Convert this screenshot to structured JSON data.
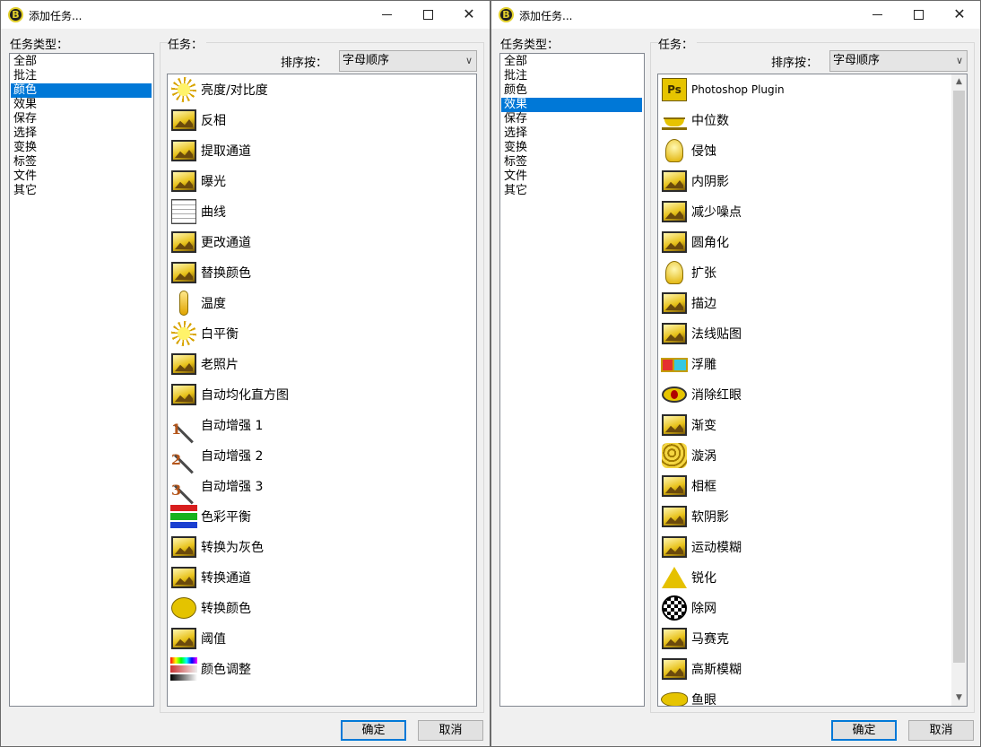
{
  "windows": [
    {
      "title": "添加任务...",
      "category_label": "任务类型：",
      "tasks_label": "任务：",
      "sort_label": "排序按：",
      "sort_value": "字母顺序",
      "categories": [
        "全部",
        "批注",
        "颜色",
        "效果",
        "保存",
        "选择",
        "变换",
        "标签",
        "文件",
        "其它"
      ],
      "selected_category": 2,
      "tasks": [
        {
          "label": "亮度/对比度",
          "icon": "brightness-sun-icon"
        },
        {
          "label": "反相",
          "icon": "invert-picture-icon"
        },
        {
          "label": "提取通道",
          "icon": "extract-channel-icon"
        },
        {
          "label": "曝光",
          "icon": "exposure-icon"
        },
        {
          "label": "曲线",
          "icon": "curves-grid-icon"
        },
        {
          "label": "更改通道",
          "icon": "change-channel-icon"
        },
        {
          "label": "替换颜色",
          "icon": "replace-color-icon"
        },
        {
          "label": "温度",
          "icon": "thermometer-icon"
        },
        {
          "label": "白平衡",
          "icon": "sun-sunglasses-icon"
        },
        {
          "label": "老照片",
          "icon": "old-photo-icon"
        },
        {
          "label": "自动均化直方图",
          "icon": "histogram-icon"
        },
        {
          "label": "自动增强 1",
          "icon": "magic-wand-1-icon"
        },
        {
          "label": "自动增强 2",
          "icon": "magic-wand-2-icon"
        },
        {
          "label": "自动增强 3",
          "icon": "magic-wand-3-icon"
        },
        {
          "label": "色彩平衡",
          "icon": "rgb-bars-icon"
        },
        {
          "label": "转换为灰色",
          "icon": "grayscale-picture-icon"
        },
        {
          "label": "转换通道",
          "icon": "convert-channel-icon"
        },
        {
          "label": "转换颜色",
          "icon": "palette-icon"
        },
        {
          "label": "阈值",
          "icon": "threshold-icon"
        },
        {
          "label": "颜色调整",
          "icon": "color-adjust-icon"
        }
      ],
      "ok_label": "确定",
      "cancel_label": "取消"
    },
    {
      "title": "添加任务...",
      "category_label": "任务类型：",
      "tasks_label": "任务：",
      "sort_label": "排序按：",
      "sort_value": "字母顺序",
      "categories": [
        "全部",
        "批注",
        "颜色",
        "效果",
        "保存",
        "选择",
        "变换",
        "标签",
        "文件",
        "其它"
      ],
      "selected_category": 3,
      "tasks": [
        {
          "label": "Photoshop Plugin",
          "icon": "photoshop-plugin-icon",
          "latin": true
        },
        {
          "label": "中位数",
          "icon": "scale-icon"
        },
        {
          "label": "侵蚀",
          "icon": "lightbulb-icon"
        },
        {
          "label": "内阴影",
          "icon": "inner-shadow-icon"
        },
        {
          "label": "减少噪点",
          "icon": "reduce-noise-icon"
        },
        {
          "label": "圆角化",
          "icon": "round-corners-icon"
        },
        {
          "label": "扩张",
          "icon": "dilate-bulb-icon"
        },
        {
          "label": "描边",
          "icon": "stroke-border-icon"
        },
        {
          "label": "法线贴图",
          "icon": "normal-map-icon"
        },
        {
          "label": "浮雕",
          "icon": "3d-glasses-icon"
        },
        {
          "label": "消除红眼",
          "icon": "red-eye-icon"
        },
        {
          "label": "渐变",
          "icon": "gradient-brush-icon"
        },
        {
          "label": "漩涡",
          "icon": "swirl-icon"
        },
        {
          "label": "相框",
          "icon": "frame-icon"
        },
        {
          "label": "软阴影",
          "icon": "soft-shadow-icon"
        },
        {
          "label": "运动模糊",
          "icon": "motion-blur-icon"
        },
        {
          "label": "锐化",
          "icon": "sharpen-triangle-icon"
        },
        {
          "label": "除网",
          "icon": "descreen-icon"
        },
        {
          "label": "马赛克",
          "icon": "mosaic-icon"
        },
        {
          "label": "高斯模糊",
          "icon": "gaussian-blur-icon"
        },
        {
          "label": "鱼眼",
          "icon": "fisheye-icon"
        }
      ],
      "ok_label": "确定",
      "cancel_label": "取消"
    }
  ],
  "colors": {
    "selection": "#0078d7",
    "default_button_border": "#0078d7",
    "dialog_bg": "#f0f0f0"
  }
}
